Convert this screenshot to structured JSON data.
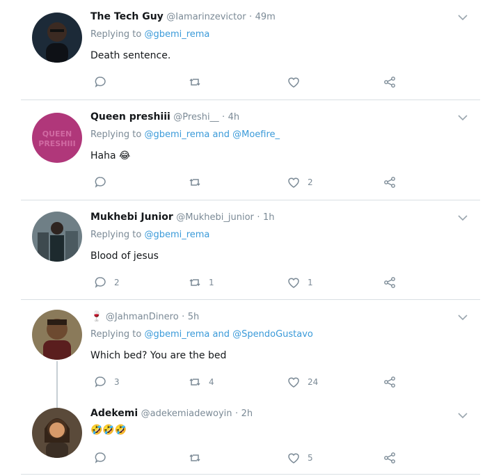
{
  "tweets": [
    {
      "name": "The Tech Guy",
      "handle": "@Iamarinzevictor",
      "dot": "·",
      "time": "49m",
      "replying_prefix": "Replying to ",
      "mention1": "@gbemi_rema",
      "mention_join": "",
      "mention2": "",
      "text": "Death sentence.",
      "counts": {
        "reply": "",
        "retweet": "",
        "like": ""
      }
    },
    {
      "name": "Queen preshiii",
      "handle": "@Preshi__",
      "dot": "·",
      "time": "4h",
      "replying_prefix": "Replying to ",
      "mention1": "@gbemi_rema",
      "mention_join": " and ",
      "mention2": "@Moefire_",
      "text": "Haha 😂",
      "avatar_text": "QUEEN PRESHIII",
      "counts": {
        "reply": "",
        "retweet": "",
        "like": "2"
      }
    },
    {
      "name": "Mukhebi Junior",
      "handle": "@Mukhebi_junior",
      "dot": "·",
      "time": "1h",
      "replying_prefix": "Replying to ",
      "mention1": "@gbemi_rema",
      "mention_join": "",
      "mention2": "",
      "text": "Blood of jesus",
      "counts": {
        "reply": "2",
        "retweet": "1",
        "like": "1"
      }
    },
    {
      "name": "",
      "name_glyph": "🍷",
      "handle": "@JahmanDinero",
      "dot": "·",
      "time": "5h",
      "replying_prefix": "Replying to ",
      "mention1": "@gbemi_rema",
      "mention_join": " and ",
      "mention2": "@SpendoGustavo",
      "text": "Which bed? You are the bed",
      "counts": {
        "reply": "3",
        "retweet": "4",
        "like": "24"
      }
    },
    {
      "name": "Adekemi",
      "handle": "@adekemiadewoyin",
      "dot": "·",
      "time": "2h",
      "replying_prefix": "",
      "mention1": "",
      "mention_join": "",
      "mention2": "",
      "text": "🤣🤣🤣",
      "counts": {
        "reply": "",
        "retweet": "",
        "like": "5"
      }
    }
  ],
  "icons": {
    "reply": "reply-icon",
    "retweet": "retweet-icon",
    "like": "heart-icon",
    "share": "share-icon",
    "caret": "chevron-down-icon"
  },
  "colors": {
    "mention": "#3a9ad9",
    "muted": "#7b8a96",
    "divider": "#d9dfe3"
  }
}
